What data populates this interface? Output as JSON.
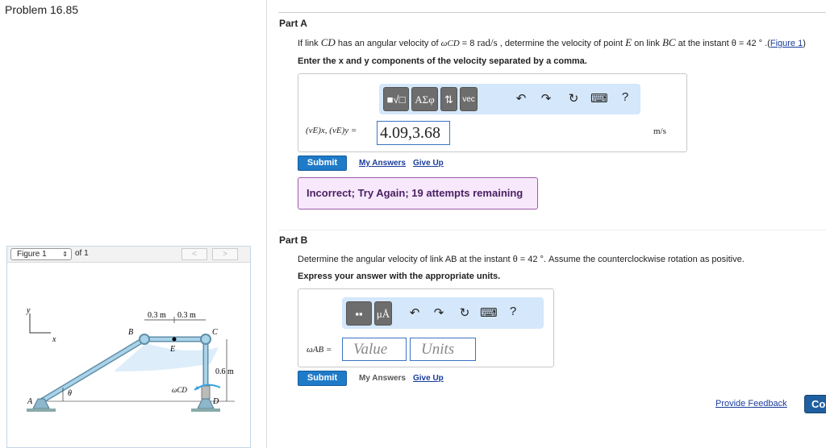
{
  "problem_title": "Problem 16.85",
  "figure_panel": {
    "select_value": "Figure 1",
    "of_label": "of 1",
    "prev": "<",
    "next": ">",
    "labels": {
      "y": "y",
      "x": "x",
      "A": "A",
      "B": "B",
      "C": "C",
      "D": "D",
      "E": "E",
      "theta": "θ",
      "omega": "ωCD",
      "dim1": "0.3 m",
      "dim2": "0.3 m",
      "dim3": "0.6 m"
    }
  },
  "partA": {
    "label": "Part A",
    "q_pre": "If link ",
    "q_cd": "CD",
    "q_mid1": " has an angular velocity of ",
    "q_omega": "ωCD",
    "q_eq": " = 8 ",
    "q_unit": "rad/s",
    "q_mid2": " , determine the velocity of point ",
    "q_e": "E",
    "q_mid3": " on link ",
    "q_bc": "BC",
    "q_mid4": " at the instant ",
    "q_theta": "θ = 42 °",
    ".": "",
    "q_dot": " .(",
    "q_link": "Figure 1",
    "q_close": ")",
    "instruction": "Enter the x and y components of the velocity separated by a comma.",
    "toolbar": {
      "templates": "■√□",
      "greek": "ΑΣφ",
      "arrows": "⇅",
      "vec": "vec",
      "undo": "↶",
      "redo": "↷",
      "reset": "↻",
      "keyboard": "⌨",
      "help": "?"
    },
    "answer_label": "(vE)x, (vE)y =",
    "answer_value": "4.09,3.68",
    "unit": "m/s",
    "submit": "Submit",
    "my_answers": "My Answers",
    "give_up": "Give Up",
    "feedback": "Incorrect; Try Again; 19 attempts remaining"
  },
  "partB": {
    "label": "Part B",
    "question": "Determine the angular velocity of link AB at the instant θ = 42 °. Assume the counterclockwise rotation as positive.",
    "instruction": "Express your answer with the appropriate units.",
    "toolbar": {
      "templates": "▪▪",
      "units": "μÅ",
      "undo": "↶",
      "redo": "↷",
      "reset": "↻",
      "keyboard": "⌨",
      "help": "?"
    },
    "answer_label": "ωAB =",
    "value_placeholder": "Value",
    "units_placeholder": "Units",
    "submit": "Submit",
    "my_answers": "My Answers",
    "give_up": "Give Up"
  },
  "footer": {
    "provide_feedback": "Provide Feedback",
    "continue": "Co"
  }
}
